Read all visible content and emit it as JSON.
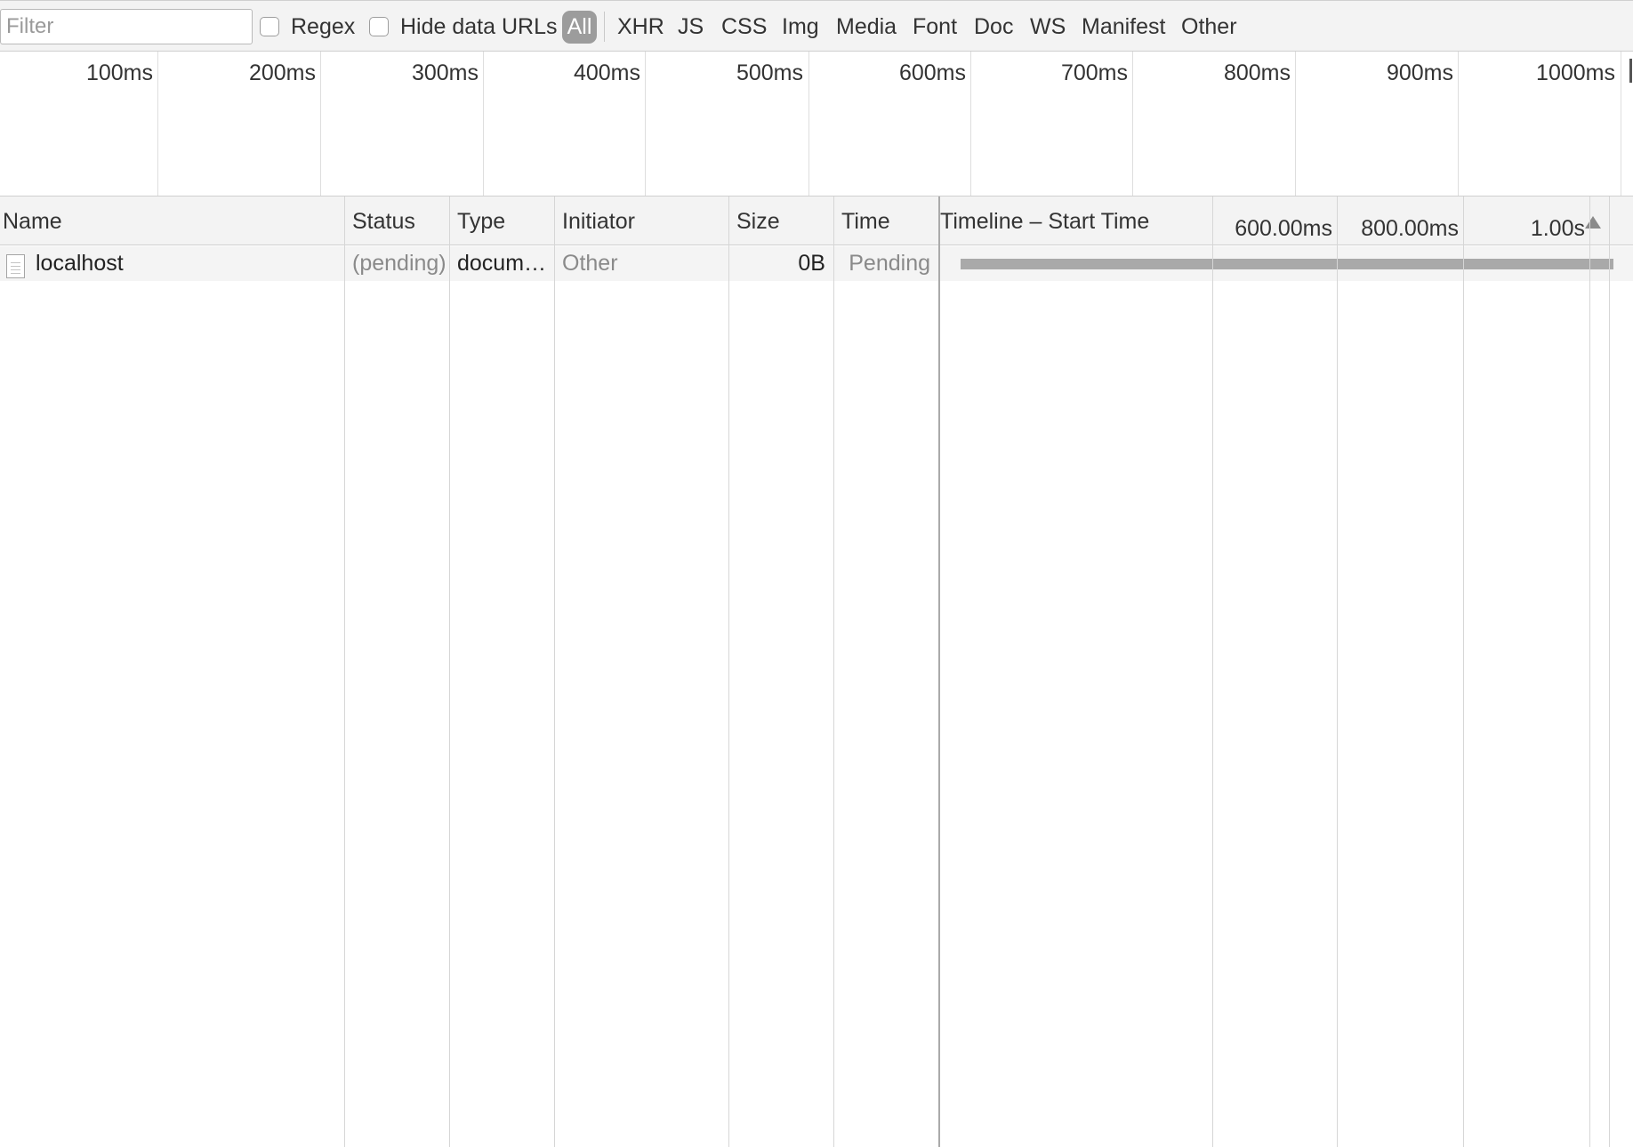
{
  "toolbar": {
    "filter_placeholder": "Filter",
    "regex_label": "Regex",
    "hide_data_urls_label": "Hide data URLs",
    "types": [
      "All",
      "XHR",
      "JS",
      "CSS",
      "Img",
      "Media",
      "Font",
      "Doc",
      "WS",
      "Manifest",
      "Other"
    ],
    "selected_type": "All"
  },
  "overview": {
    "ticks": [
      "100ms",
      "200ms",
      "300ms",
      "400ms",
      "500ms",
      "600ms",
      "700ms",
      "800ms",
      "900ms",
      "1000ms"
    ]
  },
  "columns": {
    "name": "Name",
    "status": "Status",
    "type": "Type",
    "initiator": "Initiator",
    "size": "Size",
    "time": "Time",
    "timeline": "Timeline – Start Time",
    "timeline_ticks": [
      "600.00ms",
      "800.00ms",
      "1.00s"
    ]
  },
  "requests": [
    {
      "name": "localhost",
      "status": "(pending)",
      "type": "docum…",
      "initiator": "Other",
      "size": "0B",
      "time": "Pending"
    }
  ],
  "colors": {
    "toolbar_bg": "#f3f3f3",
    "selected_chip": "#9c9c9c",
    "waterfall_bar": "#a9a9a9",
    "row_bg": "#f4f4f4",
    "muted_text": "#8a8a8a"
  }
}
